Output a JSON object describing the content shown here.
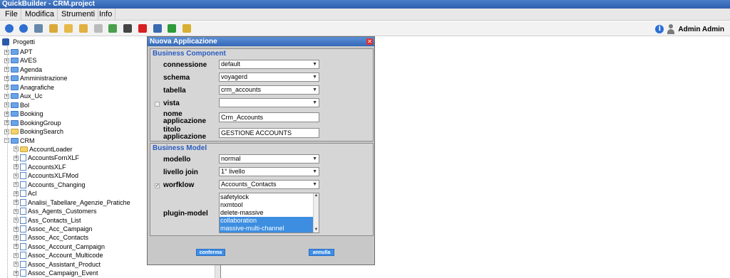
{
  "window": {
    "title": "QuickBuilder - CRM.project"
  },
  "menu": [
    "File",
    "Modifica",
    "Strumenti",
    "Info"
  ],
  "toolbar": {
    "icons": [
      {
        "name": "back-icon",
        "color": "#2f6fd0"
      },
      {
        "name": "forward-icon",
        "color": "#2f6fd0"
      },
      {
        "name": "save-icon",
        "color": "#6688aa"
      },
      {
        "name": "new-project-icon",
        "color": "#d9a93a"
      },
      {
        "name": "open-project-icon",
        "color": "#e6b94a"
      },
      {
        "name": "open-folder-icon",
        "color": "#e0b040"
      },
      {
        "name": "new-document-icon",
        "color": "#bbbbbb"
      },
      {
        "name": "import-icon",
        "color": "#4aa04a"
      },
      {
        "name": "settings-icon",
        "color": "#444444"
      },
      {
        "name": "delete-icon",
        "color": "#d82020"
      },
      {
        "name": "table-icon",
        "color": "#3a6ab0"
      },
      {
        "name": "export-icon",
        "color": "#2e9a3a"
      },
      {
        "name": "wizard-icon",
        "color": "#d9b030"
      }
    ]
  },
  "user": {
    "name": "Admin Admin"
  },
  "tree": {
    "root": "Progetti",
    "items": [
      {
        "label": "APT",
        "type": "folder"
      },
      {
        "label": "AVES",
        "type": "folder"
      },
      {
        "label": "Agenda",
        "type": "folder"
      },
      {
        "label": "Amministrazione",
        "type": "folder"
      },
      {
        "label": "Anagrafiche",
        "type": "folder"
      },
      {
        "label": "Aux_Uc",
        "type": "folder"
      },
      {
        "label": "Bol",
        "type": "folder"
      },
      {
        "label": "Booking",
        "type": "folder"
      },
      {
        "label": "BookingGroup",
        "type": "folder"
      },
      {
        "label": "BookingSearch",
        "type": "folder-yellow"
      },
      {
        "label": "CRM",
        "type": "folder-open"
      }
    ],
    "crm_children": [
      {
        "label": "AccountLoader",
        "type": "folder-yellow"
      },
      {
        "label": "AccountsFornXLF",
        "type": "page"
      },
      {
        "label": "AccountsXLF",
        "type": "page"
      },
      {
        "label": "AccountsXLFMod",
        "type": "page"
      },
      {
        "label": "Accounts_Changing",
        "type": "page"
      },
      {
        "label": "Acl",
        "type": "page"
      },
      {
        "label": "Analisi_Tabellare_Agenzie_Pratiche",
        "type": "page"
      },
      {
        "label": "Ass_Agents_Customers",
        "type": "page"
      },
      {
        "label": "Ass_Contacts_List",
        "type": "page"
      },
      {
        "label": "Assoc_Acc_Campaign",
        "type": "page"
      },
      {
        "label": "Assoc_Acc_Contacts",
        "type": "page"
      },
      {
        "label": "Assoc_Account_Campaign",
        "type": "page"
      },
      {
        "label": "Assoc_Account_Multicode",
        "type": "page"
      },
      {
        "label": "Assoc_Assistant_Product",
        "type": "page"
      },
      {
        "label": "Assoc_Campaign_Event",
        "type": "page"
      }
    ]
  },
  "dialog": {
    "title": "Nuova Applicazione",
    "business_component": {
      "legend": "Business Component",
      "connessione_label": "connessione",
      "connessione_value": "default",
      "schema_label": "schema",
      "schema_value": "voyagerd",
      "tabella_label": "tabella",
      "tabella_value": "crm_accounts",
      "vista_label": "vista",
      "vista_value": "",
      "nome_label_1": "nome",
      "nome_label_2": "applicazione",
      "nome_value": "Crm_Accounts",
      "titolo_label_1": "titolo",
      "titolo_label_2": "applicazione",
      "titolo_value": "GESTIONE ACCOUNTS"
    },
    "business_model": {
      "legend": "Business Model",
      "modello_label": "modello",
      "modello_value": "normal",
      "livello_label": "livello join",
      "livello_value": "1° livello",
      "workflow_label": "worfklow",
      "workflow_checked": true,
      "workflow_value": "Accounts_Contacts",
      "plugin_label": "plugin-model",
      "plugins": [
        {
          "label": "safetylock",
          "selected": false
        },
        {
          "label": "nxmtool",
          "selected": false
        },
        {
          "label": "delete-massive",
          "selected": false
        },
        {
          "label": "collaboration",
          "selected": true
        },
        {
          "label": "massive-multi-channel",
          "selected": true
        }
      ]
    },
    "buttons": {
      "confirm": "conferma",
      "cancel": "annulla"
    }
  }
}
